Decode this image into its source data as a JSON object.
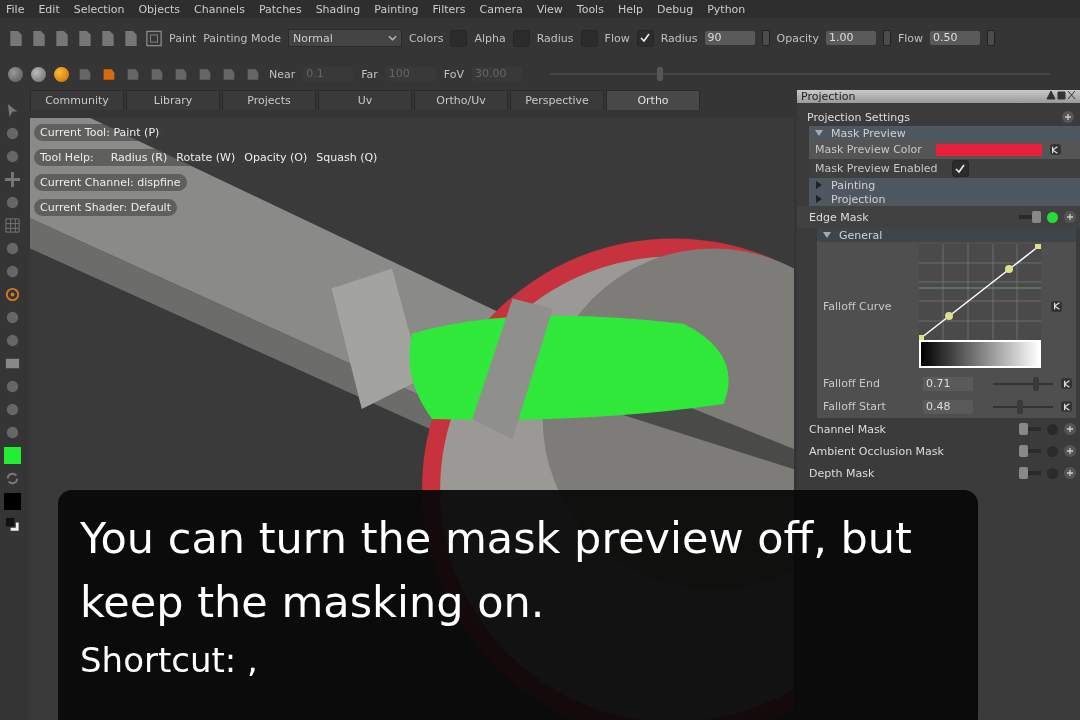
{
  "menu": [
    "File",
    "Edit",
    "Selection",
    "Objects",
    "Channels",
    "Patches",
    "Shading",
    "Painting",
    "Filters",
    "Camera",
    "View",
    "Tools",
    "Help",
    "Debug",
    "Python"
  ],
  "toolbar": {
    "paint_label": "Paint",
    "painting_mode": {
      "label": "Painting Mode",
      "value": "Normal"
    },
    "toggles": [
      {
        "label": "Colors",
        "checked": false
      },
      {
        "label": "Alpha",
        "checked": false
      },
      {
        "label": "Radius",
        "checked": false
      },
      {
        "label": "Flow",
        "checked": true
      }
    ],
    "fields": [
      {
        "label": "Radius",
        "value": "90"
      },
      {
        "label": "Opacity",
        "value": "1.00"
      },
      {
        "label": "Flow",
        "value": "0.50"
      }
    ]
  },
  "view_toolbar": {
    "slider": {
      "level": 0.22
    },
    "fields": [
      {
        "label": "Near",
        "value": "0.1",
        "disabled": true
      },
      {
        "label": "Far",
        "value": "100",
        "disabled": true
      },
      {
        "label": "FoV",
        "value": "30.00",
        "disabled": true
      }
    ]
  },
  "tabs": [
    {
      "label": "Community",
      "selected": false
    },
    {
      "label": "Library",
      "selected": false
    },
    {
      "label": "Projects",
      "selected": false
    },
    {
      "label": "Uv",
      "selected": false
    },
    {
      "label": "Ortho/Uv",
      "selected": false
    },
    {
      "label": "Perspective",
      "selected": false
    },
    {
      "label": "Ortho",
      "selected": true
    }
  ],
  "hud": {
    "current_tool": "Current Tool: Paint (P)",
    "tool_help_label": "Tool Help:",
    "tool_help_keys": [
      "Radius (R)",
      "Rotate (W)",
      "Opacity (O)",
      "Squash (Q)"
    ],
    "current_channel": "Current Channel: dispfine",
    "current_shader": "Current Shader: Default"
  },
  "color_swatches": [
    {
      "color": "#22ee33"
    },
    {
      "color": "#000000"
    }
  ],
  "panel": {
    "title": "Projection",
    "section": "Projection Settings",
    "mask_preview": {
      "title": "Mask Preview",
      "expanded": true,
      "rows": [
        {
          "kind": "color",
          "label": "Mask Preview Color",
          "color": "#e8203a"
        },
        {
          "kind": "checkbox",
          "label": "Mask Preview Enabled",
          "checked": true
        }
      ]
    },
    "groups": [
      {
        "title": "Painting",
        "expanded": false
      },
      {
        "title": "Projection",
        "expanded": false
      }
    ],
    "edge_mask": {
      "title": "Edge Mask",
      "enabled": true,
      "general": "General",
      "curve_label": "Falloff Curve",
      "sliders": [
        {
          "label": "Falloff End",
          "value": "0.71",
          "level": 0.72
        },
        {
          "label": "Falloff Start",
          "value": "0.48",
          "level": 0.45
        }
      ]
    },
    "masks": [
      {
        "name": "Channel Mask",
        "enabled": false
      },
      {
        "name": "Ambient Occlusion Mask",
        "enabled": false
      },
      {
        "name": "Depth Mask",
        "enabled": false
      }
    ]
  },
  "subtitle": {
    "lines": [
      "You can turn the mask preview off, but",
      "keep the masking on."
    ],
    "shortcut": "Shortcut: ,"
  }
}
